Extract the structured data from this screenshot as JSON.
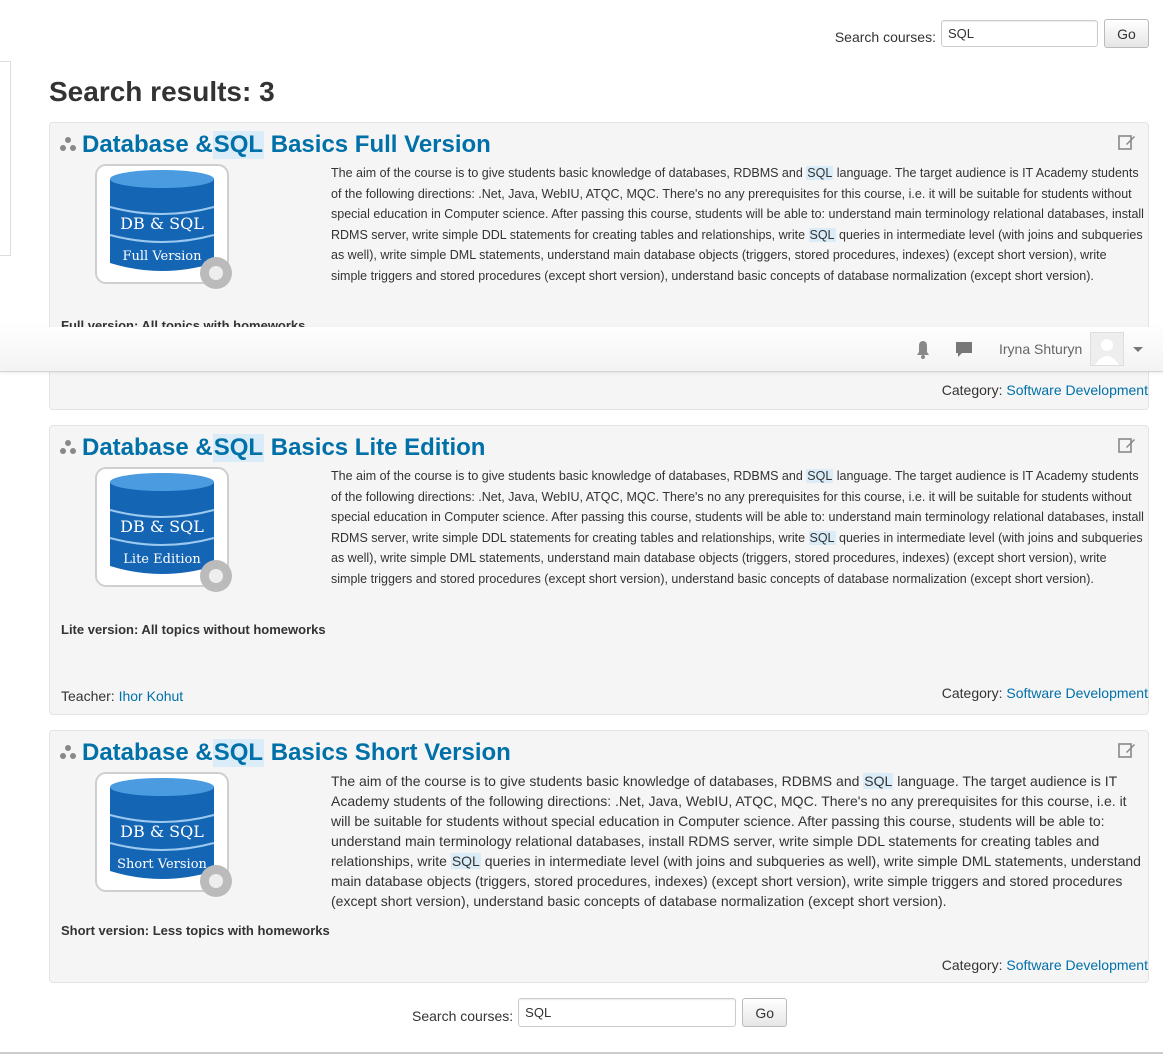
{
  "search": {
    "label": "Search courses:",
    "value": "SQL",
    "go_label": "Go"
  },
  "heading": "Search results: 3",
  "courses": [
    {
      "title_pre": "Database & ",
      "title_hl": "SQL",
      "title_post": " Basics Full Version",
      "image_line1": "DB & SQL",
      "image_line2": "Full Version",
      "summary": [
        "The aim of the course is to give students basic knowledge of databases, RDBMS and ",
        "SQL",
        " language. The target audience is IT Academy students of the following directions: .Net, Java, WebIU, ATQC, MQC. There's no any prerequisites for this course, i.e. it will be suitable for students without special education in Computer science. After passing this course, students will be able to: understand main terminology relational databases, install RDMS server, write simple DDL statements for creating tables and relationships, write ",
        "SQL",
        " queries in intermediate level (with joins and subqueries as well), write simple DML statements, understand main database objects (triggers, stored procedures, indexes) (except short version), write simple triggers and stored procedures (except short version), understand basic concepts of database normalization (except short version)."
      ],
      "subtitle": "Full version: All topics with homeworks",
      "category_label": "Category:",
      "category": "Software Development"
    },
    {
      "title_pre": "Database & ",
      "title_hl": "SQL",
      "title_post": " Basics Lite Edition",
      "image_line1": "DB & SQL",
      "image_line2": "Lite Edition",
      "summary": [
        "The aim of the course is to give students basic knowledge of databases, RDBMS and ",
        "SQL",
        " language. The target audience is IT Academy students of the following directions: .Net, Java, WebIU, ATQC, MQC. There's no any prerequisites for this course, i.e. it will be suitable for students without special education in Computer science. After passing this course, students will be able to: understand main terminology relational databases, install RDMS server, write simple DDL statements for creating tables and relationships, write ",
        "SQL",
        " queries in intermediate level (with joins and subqueries as well), write simple DML statements, understand main database objects (triggers, stored procedures, indexes) (except short version), write simple triggers and stored procedures (except short version), understand basic concepts of database normalization (except short version)."
      ],
      "subtitle": "Lite version: All topics without homeworks",
      "teacher_label": "Teacher:",
      "teacher": "Ihor Kohut",
      "category_label": "Category:",
      "category": "Software Development"
    },
    {
      "title_pre": "Database & ",
      "title_hl": "SQL",
      "title_post": " Basics Short Version",
      "image_line1": "DB & SQL",
      "image_line2": "Short Version",
      "summary": [
        "The aim of the course is to give students basic knowledge of databases, RDBMS and ",
        "SQL",
        " language. The target audience is IT Academy students of the following directions: .Net, Java, WebIU, ATQC, MQC. There's no any prerequisites for this course, i.e. it will be suitable for students without special education in Computer science. After passing this course, students will be able to: understand main terminology relational databases, install RDMS server, write simple DDL statements for creating tables and relationships, write ",
        "SQL",
        " queries in intermediate level (with joins and subqueries as well), write simple DML statements, understand main database objects (triggers, stored procedures, indexes) (except short version), write simple triggers and stored procedures (except short version), understand basic concepts of database normalization (except short version)."
      ],
      "subtitle": "Short version: Less topics with homeworks",
      "category_label": "Category:",
      "category": "Software Development"
    }
  ],
  "navbar": {
    "user_name": "Iryna Shturyn",
    "icons": [
      "notification-bell-icon",
      "message-icon",
      "user-menu-caret-icon"
    ]
  },
  "colors": {
    "link": "#0070a8",
    "highlight": "#d9ecf7",
    "box_bg": "#f5f5f5",
    "db_blue": "#1565b5"
  }
}
